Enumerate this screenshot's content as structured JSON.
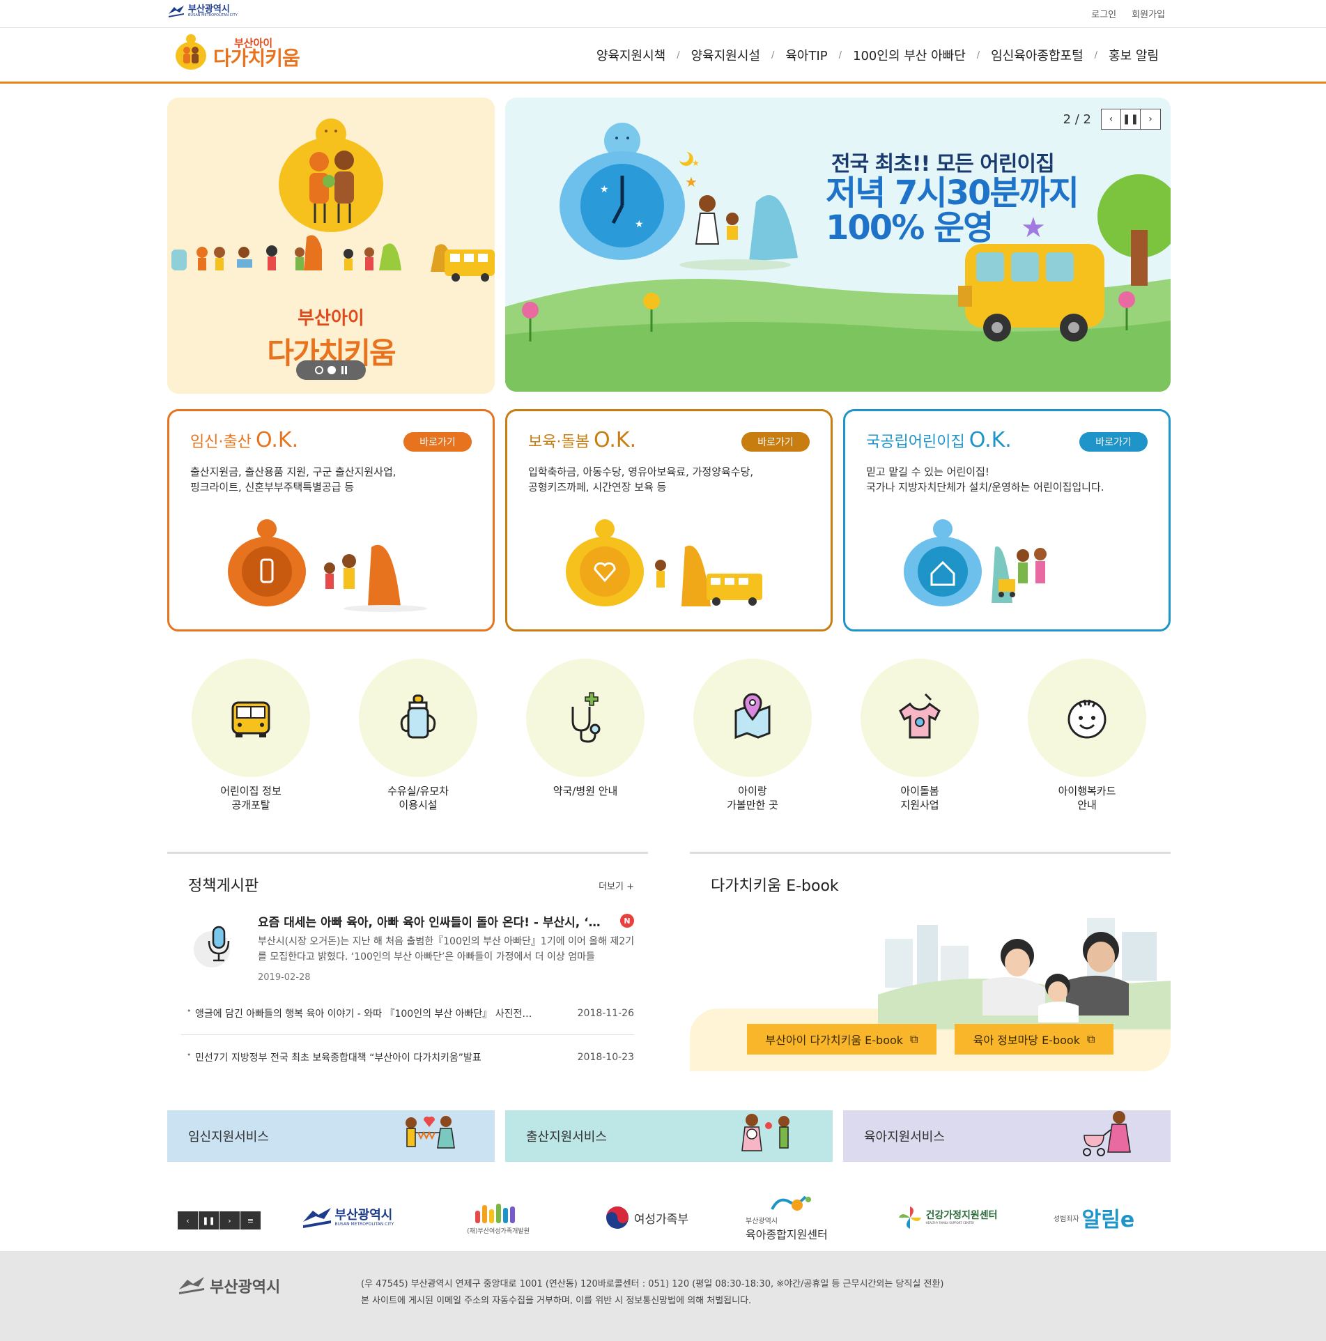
{
  "utilbar": {
    "city_name": "부산광역시",
    "city_name_en": "BUSAN METROPOLITAN CITY",
    "login": "로그인",
    "signup": "회원가입"
  },
  "header": {
    "brand_sub": "부산아이",
    "brand_main": "다가치키움",
    "nav": [
      "양육지원시책",
      "양육지원시설",
      "육아TIP",
      "100인의 부산 아빠단",
      "임신육아종합포털",
      "홍보 알림"
    ],
    "accent_color": "#e8821e"
  },
  "hero": {
    "left": {
      "brand_sub": "부산아이",
      "brand_main": "다가치키움"
    },
    "right": {
      "counter": "2 / 2",
      "line1": "전국 최초!! 모든 어린이집",
      "line2": "저녁 7시30분까지",
      "line3": "100% 운영"
    }
  },
  "ok_cards": [
    {
      "title": "임신·출산",
      "ok": "O.K.",
      "button": "바로가기",
      "desc1": "출산지원금, 출산용품 지원, 구군 출산지원사업,",
      "desc2": "핑크라이트, 신혼부부주택특별공급 등",
      "color": "#e8731e"
    },
    {
      "title": "보육·돌봄",
      "ok": "O.K.",
      "button": "바로가기",
      "desc1": "입학축하금, 아동수당, 영유아보육료, 가정양육수당,",
      "desc2": "공형키즈까페, 시간연장 보육 등",
      "color": "#c77d10"
    },
    {
      "title": "국공립어린이집",
      "ok": "O.K.",
      "button": "바로가기",
      "desc1": "믿고 맡길 수 있는 어린이집!",
      "desc2": "국가나 지방자치단체가 설치/운영하는 어린이집입니다.",
      "color": "#1e94c8"
    }
  ],
  "quick_links": [
    {
      "label": "어린이집 정보\n공개포탈",
      "icon": "school-bus-icon"
    },
    {
      "label": "수유실/유모차\n이용시설",
      "icon": "baby-bottle-icon"
    },
    {
      "label": "약국/병원 안내",
      "icon": "stethoscope-icon"
    },
    {
      "label": "아이랑\n가볼만한 곳",
      "icon": "map-pin-icon"
    },
    {
      "label": "아이돌봄\n지원사업",
      "icon": "baby-clothes-icon"
    },
    {
      "label": "아이행복카드\n안내",
      "icon": "baby-face-icon"
    }
  ],
  "board": {
    "title": "정책게시판",
    "more": "더보기 +",
    "featured": {
      "title": "요즘 대세는 아빠 육아, 아빠 육아 인싸들이 돌아 온다! - 부산시, ‘…",
      "badge": "N",
      "body": "부산시(시장 오거돈)는 지난 해 처음 출범한『100인의 부산 아빠단』1기에 이어 올해 제2기를 모집한다고 밝혔다. ‘100인의 부산 아빠단’은 아빠들이 가정에서 더 이상 엄마들",
      "date": "2019-02-28"
    },
    "items": [
      {
        "title": "앵글에 담긴 아빠들의 행복 육아 이야기 - 와따 『100인의 부산 아빠단』 사진전…",
        "date": "2018-11-26"
      },
      {
        "title": "민선7기 지방정부 전국 최초 보육종합대책 “부산아이 다가치키움”발표",
        "date": "2018-10-23"
      }
    ]
  },
  "ebook": {
    "title": "다가치키움 E-book",
    "buttons": [
      "부산아이 다가치키움 E-book",
      "육아 정보마당 E-book"
    ]
  },
  "services": [
    {
      "label": "임신지원서비스",
      "color": "#cbe2f2"
    },
    {
      "label": "출산지원서비스",
      "color": "#bde6e6"
    },
    {
      "label": "육아지원서비스",
      "color": "#dcdaee"
    }
  ],
  "partners": [
    {
      "name": "부산광역시",
      "sub": "BUSAN METROPOLITAN CITY"
    },
    {
      "name": "(재)부산여성가족개발원",
      "sub": ""
    },
    {
      "name": "여성가족부",
      "sub": ""
    },
    {
      "name": "부산광역시",
      "sub": "육아종합지원센터"
    },
    {
      "name": "건강가정지원센터",
      "sub": "HEALTHY FAMILY SUPPORT CENTER"
    },
    {
      "name": "알림e",
      "sub": "성범죄자"
    }
  ],
  "footer": {
    "logo": "부산광역시",
    "address": "(우 47545) 부산광역시 연제구 중앙대로 1001 (연산동) 120바로콜센터 : 051) 120 (평일 08:30-18:30, ※야간/공휴일 등 근무시간외는 당직실 전환)",
    "notice": "본 사이트에 게시된 이메일 주소의 자동수집을 거부하며, 이를 위반 시 정보통신망법에 의해 처벌됩니다."
  }
}
